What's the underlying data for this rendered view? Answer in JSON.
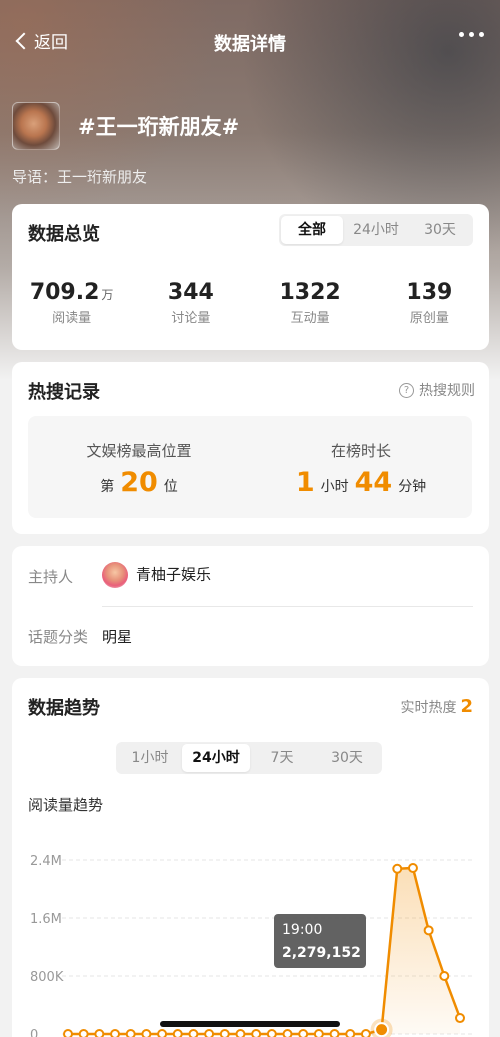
{
  "nav": {
    "back_label": "返回",
    "title": "数据详情"
  },
  "topic": {
    "title": "#王一珩新朋友#",
    "guide": "导语：王一珩新朋友"
  },
  "overview": {
    "title": "数据总览",
    "tabs": [
      "全部",
      "24小时",
      "30天"
    ],
    "active_tab": "全部",
    "stats": [
      {
        "value": "709.2",
        "unit": "万",
        "label": "阅读量"
      },
      {
        "value": "344",
        "unit": "",
        "label": "讨论量"
      },
      {
        "value": "1322",
        "unit": "",
        "label": "互动量"
      },
      {
        "value": "139",
        "unit": "",
        "label": "原创量"
      }
    ]
  },
  "hot": {
    "title": "热搜记录",
    "rule_label": "热搜规则",
    "position_label": "文娱榜最高位置",
    "position_prefix": "第",
    "position_value": "20",
    "position_suffix": "位",
    "duration_label": "在榜时长",
    "duration_hours": "1",
    "duration_hours_unit": "小时",
    "duration_minutes": "44",
    "duration_minutes_unit": "分钟"
  },
  "info": {
    "host_label": "主持人",
    "host_name": "青柚子娱乐",
    "category_label": "话题分类",
    "category_value": "明星"
  },
  "trend": {
    "title": "数据趋势",
    "realtime_label": "实时热度",
    "realtime_value": "2",
    "tabs": [
      "1小时",
      "24小时",
      "7天",
      "30天"
    ],
    "active_tab": "24小时",
    "sublabel": "阅读量趋势"
  },
  "chart_data": {
    "type": "line",
    "title": "阅读量趋势",
    "ylim": [
      0,
      2400000
    ],
    "y_ticks": [
      "0",
      "800K",
      "1.6M",
      "2.4M"
    ],
    "y_tick_values": [
      0,
      800000,
      1600000,
      2400000
    ],
    "grid": true,
    "color": "#f08c00",
    "values": [
      0,
      0,
      0,
      0,
      0,
      0,
      0,
      0,
      0,
      0,
      0,
      0,
      0,
      0,
      0,
      0,
      0,
      0,
      0,
      0,
      60000,
      2279152,
      2290000,
      1430000,
      800000,
      220000
    ],
    "tooltip": {
      "label": "19:00",
      "value": "2,279,152",
      "index": 20
    }
  }
}
